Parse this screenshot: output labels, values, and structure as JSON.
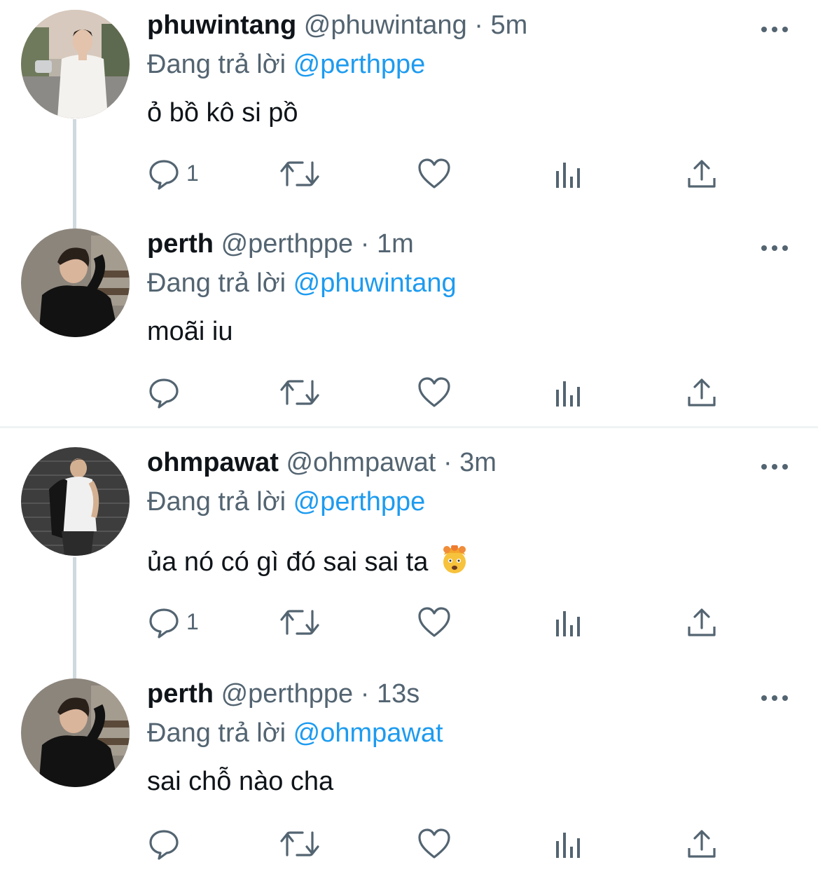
{
  "tweets": [
    {
      "name": "phuwintang",
      "handle": "@phuwintang",
      "separator": "·",
      "time": "5m",
      "reply_prefix": "Đang trả lời",
      "reply_to": "@perthppe",
      "text": "ỏ bồ kô si pồ",
      "reply_count": "1"
    },
    {
      "name": "perth",
      "handle": "@perthppe",
      "separator": "·",
      "time": "1m",
      "reply_prefix": "Đang trả lời",
      "reply_to": "@phuwintang",
      "text": "moãi iu",
      "reply_count": ""
    },
    {
      "name": "ohmpawat",
      "handle": "@ohmpawat",
      "separator": "·",
      "time": "3m",
      "reply_prefix": "Đang trả lời",
      "reply_to": "@perthppe",
      "text": "ủa nó có gì đó sai sai ta",
      "emoji": "exploding-head-emoji",
      "reply_count": "1"
    },
    {
      "name": "perth",
      "handle": "@perthppe",
      "separator": "·",
      "time": "13s",
      "reply_prefix": "Đang trả lời",
      "reply_to": "@ohmpawat",
      "text": "sai chỗ nào cha",
      "reply_count": ""
    }
  ],
  "icons": {
    "reply": "reply-icon",
    "retweet": "retweet-icon",
    "like": "heart-icon",
    "analytics": "analytics-icon",
    "share": "share-icon",
    "more": "more-icon"
  },
  "colors": {
    "text": "#0f1419",
    "secondary": "#536471",
    "link": "#1d9bf0",
    "thread_line": "#cfd9de"
  }
}
